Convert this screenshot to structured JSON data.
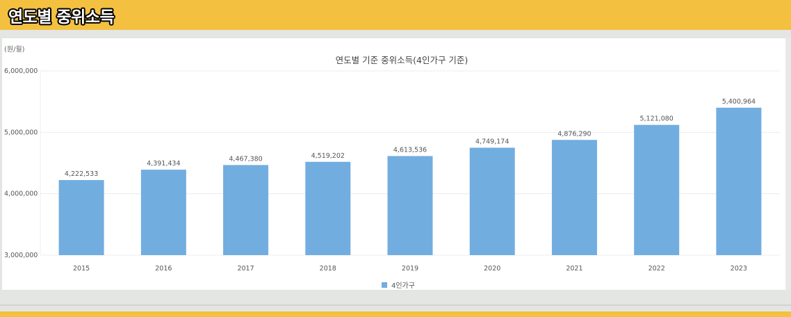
{
  "header": {
    "title": "연도별 중위소득"
  },
  "chart_data": {
    "type": "bar",
    "title": "연도별 기준 중위소득(4인가구 기준)",
    "unit_label": "(원/월)",
    "categories": [
      "2015",
      "2016",
      "2017",
      "2018",
      "2019",
      "2020",
      "2021",
      "2022",
      "2023"
    ],
    "series": [
      {
        "name": "4인가구",
        "color": "#72ade0",
        "values": [
          4222533,
          4391434,
          4467380,
          4519202,
          4613536,
          4749174,
          4876290,
          5121080,
          5400964
        ],
        "labels": [
          "4,222,533",
          "4,391,434",
          "4,467,380",
          "4,519,202",
          "4,613,536",
          "4,749,174",
          "4,876,290",
          "5,121,080",
          "5,400,964"
        ]
      }
    ],
    "yticks": [
      3000000,
      4000000,
      5000000,
      6000000
    ],
    "ytick_labels": [
      "3,000,000",
      "4,000,000",
      "5,000,000",
      "6,000,000"
    ],
    "ylim": [
      3000000,
      6000000
    ],
    "grid": true,
    "legend_position": "bottom"
  }
}
